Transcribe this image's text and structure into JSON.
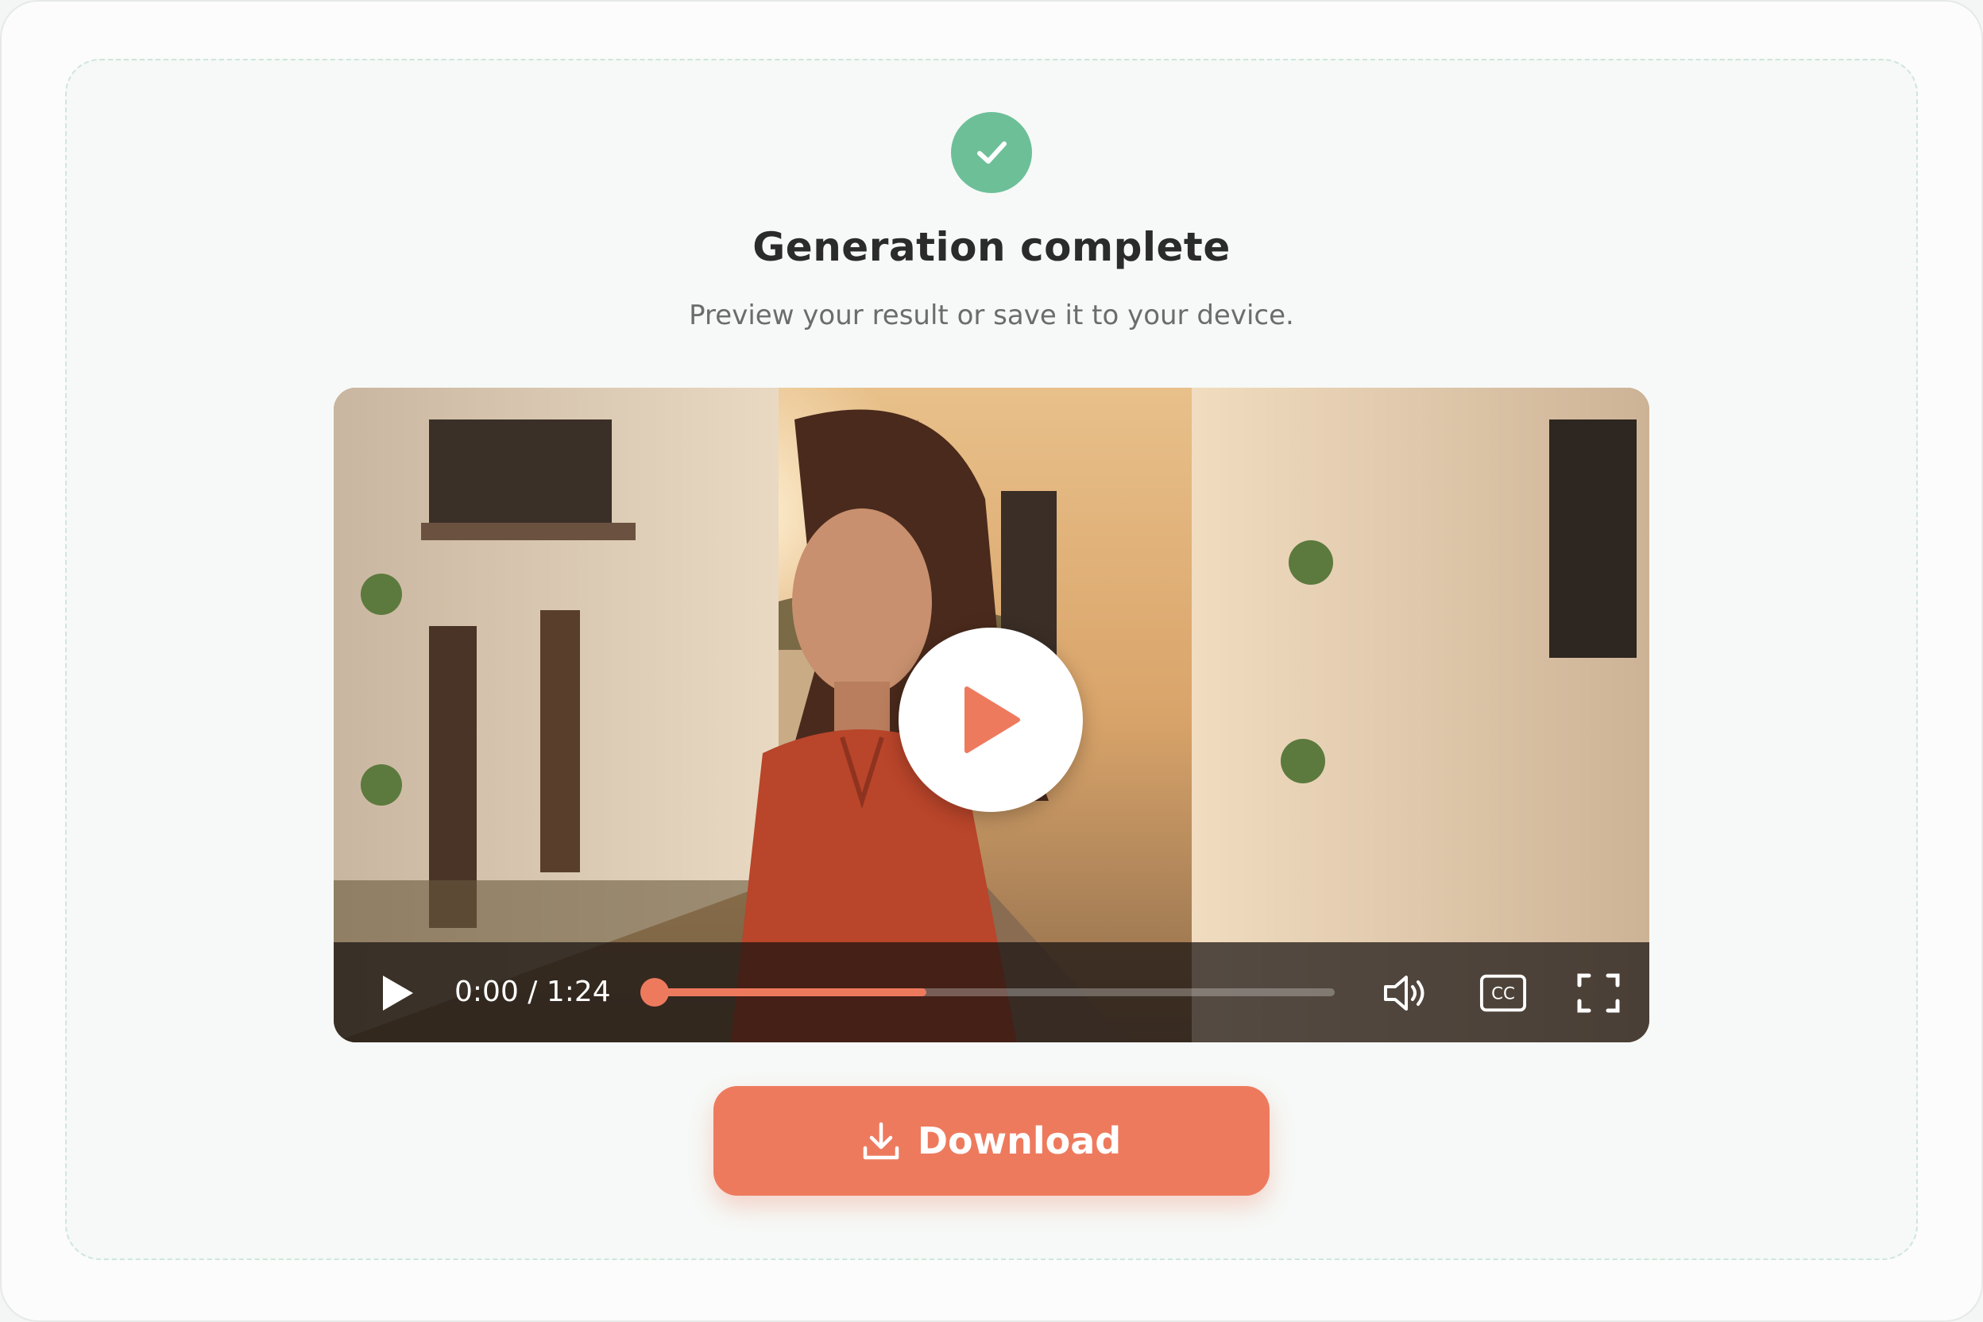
{
  "status": {
    "title": "Generation complete",
    "subtitle": "Preview your result or save it to your device."
  },
  "player": {
    "time_display": "0:00 / 1:24",
    "progress_fraction": 0.4,
    "accent": "#ee7a5e"
  },
  "actions": {
    "download_label": "Download"
  },
  "colors": {
    "success": "#6dbf98",
    "primary": "#ee7a5e"
  },
  "icons": [
    "check-icon",
    "play-icon",
    "volume-icon",
    "captions-icon",
    "fullscreen-icon",
    "download-icon"
  ]
}
